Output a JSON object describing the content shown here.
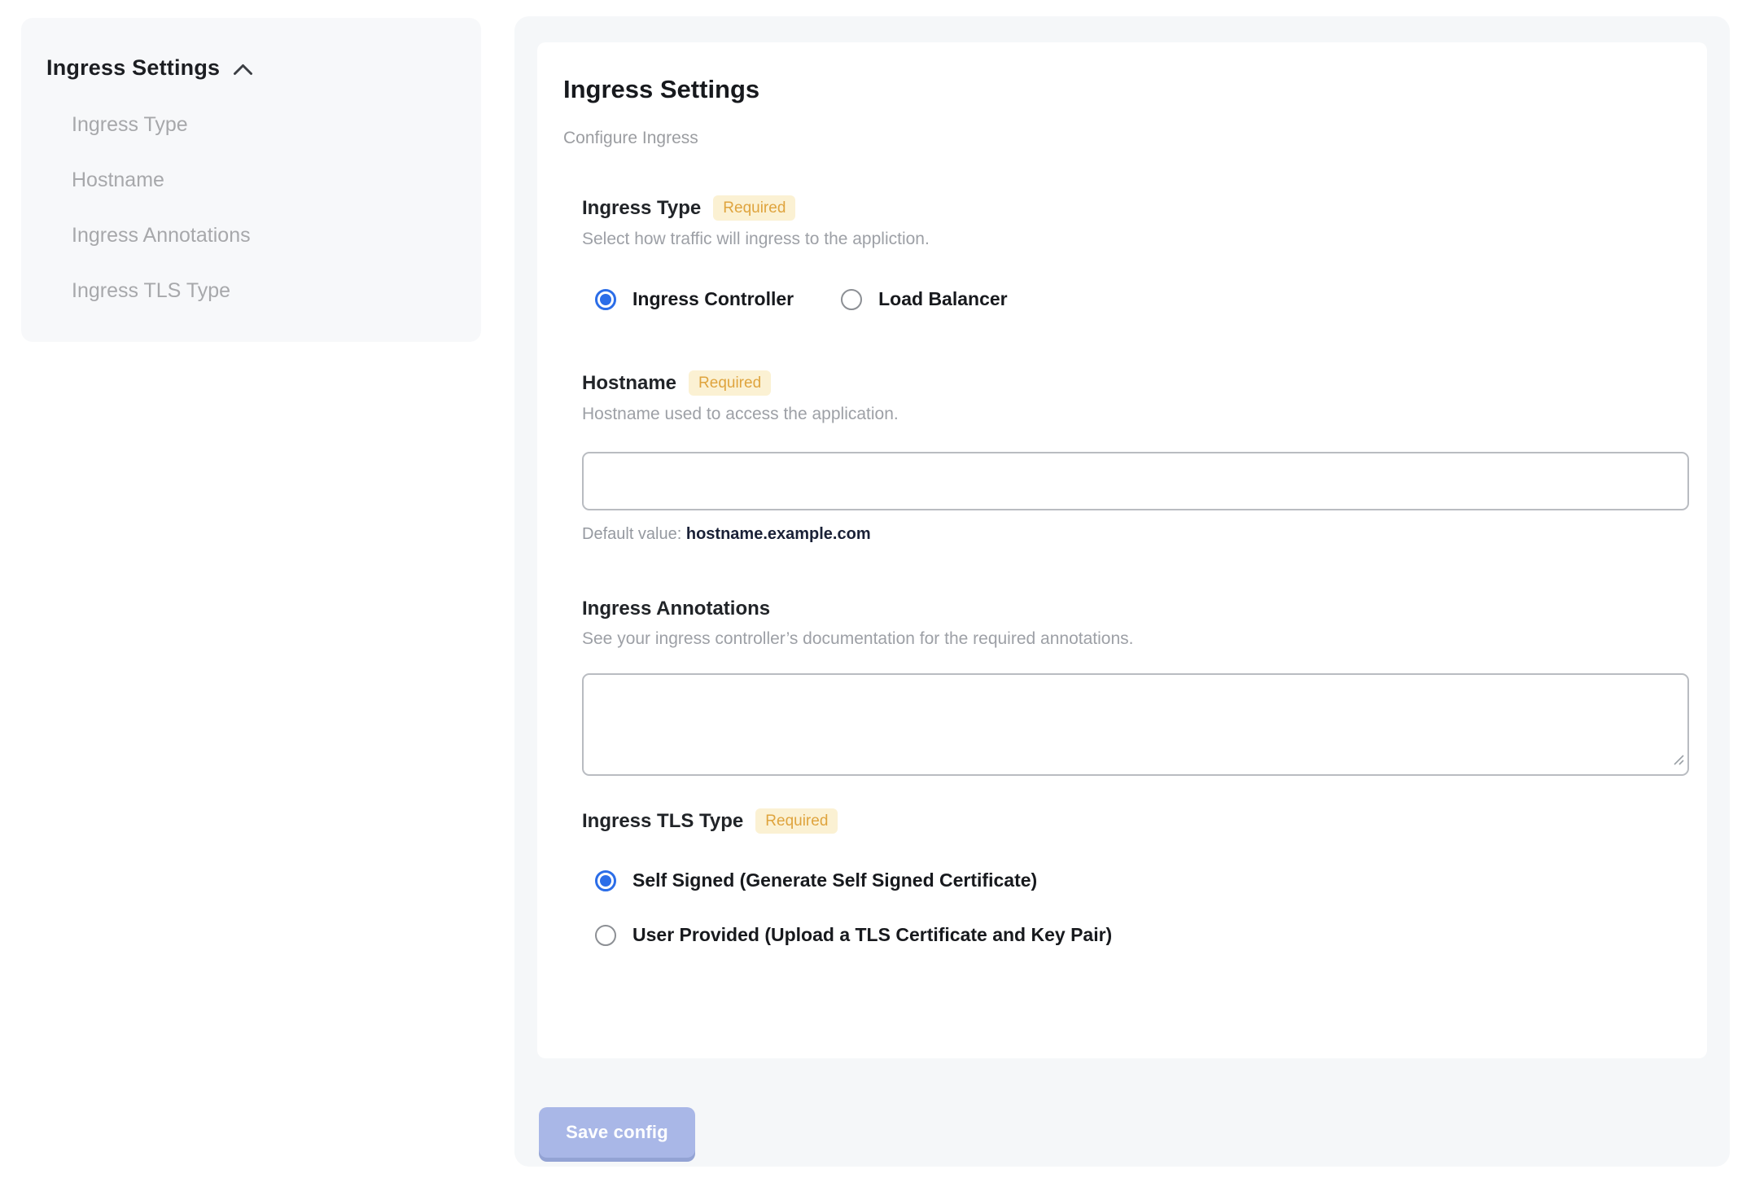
{
  "sidebar": {
    "title": "Ingress Settings",
    "collapse_icon": "chevron-up-icon",
    "items": [
      {
        "label": "Ingress Type"
      },
      {
        "label": "Hostname"
      },
      {
        "label": "Ingress Annotations"
      },
      {
        "label": "Ingress TLS Type"
      }
    ]
  },
  "panel": {
    "title": "Ingress Settings",
    "subtitle": "Configure Ingress",
    "required_badge": "Required",
    "fields": {
      "ingress_type": {
        "label": "Ingress Type",
        "required": true,
        "description": "Select how traffic will ingress to the appliction.",
        "options": [
          {
            "label": "Ingress Controller",
            "selected": true
          },
          {
            "label": "Load Balancer",
            "selected": false
          }
        ]
      },
      "hostname": {
        "label": "Hostname",
        "required": true,
        "description": "Hostname used to access the application.",
        "value": "",
        "default_prefix": "Default value: ",
        "default_value": "hostname.example.com"
      },
      "ingress_annotations": {
        "label": "Ingress Annotations",
        "required": false,
        "description": "See your ingress controller’s documentation for the required annotations.",
        "value": ""
      },
      "ingress_tls_type": {
        "label": "Ingress TLS Type",
        "required": true,
        "options": [
          {
            "label": "Self Signed (Generate Self Signed Certificate)",
            "selected": true
          },
          {
            "label": "User Provided (Upload a TLS Certificate and Key Pair)",
            "selected": false
          }
        ]
      }
    },
    "save_button": "Save config"
  },
  "colors": {
    "accent_blue": "#2b6de8",
    "badge_bg": "#fbf1d3",
    "badge_text": "#dfa43e",
    "button_bg": "#a9b7e7",
    "button_shadow": "#93a3d4",
    "panel_bg": "#f5f7f9",
    "sidebar_bg": "#f7f8fa",
    "muted_text": "#9da0a6",
    "default_value_text": "#1a2137"
  }
}
